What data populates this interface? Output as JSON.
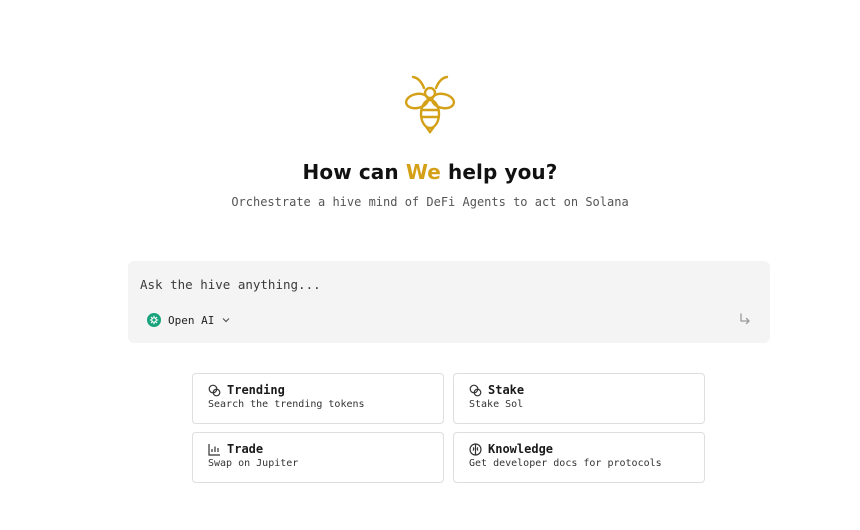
{
  "hero": {
    "headline_before": "How can ",
    "headline_accent": "We",
    "headline_after": " help you?",
    "subtitle": "Orchestrate a hive mind of DeFi Agents to act on Solana",
    "logo_icon": "bee-icon",
    "accent_color": "#d4a017"
  },
  "prompt": {
    "placeholder": "Ask the hive anything...",
    "value": "",
    "model_label": "Open AI",
    "model_icon": "openai-icon",
    "submit_icon": "enter-arrow-icon"
  },
  "actions": [
    {
      "title": "Trending",
      "subtitle": "Search the trending tokens",
      "icon": "coins-icon"
    },
    {
      "title": "Stake",
      "subtitle": "Stake Sol",
      "icon": "coins-icon"
    },
    {
      "title": "Trade",
      "subtitle": "Swap on Jupiter",
      "icon": "chart-icon"
    },
    {
      "title": "Knowledge",
      "subtitle": "Get developer docs for protocols",
      "icon": "brain-icon"
    }
  ]
}
